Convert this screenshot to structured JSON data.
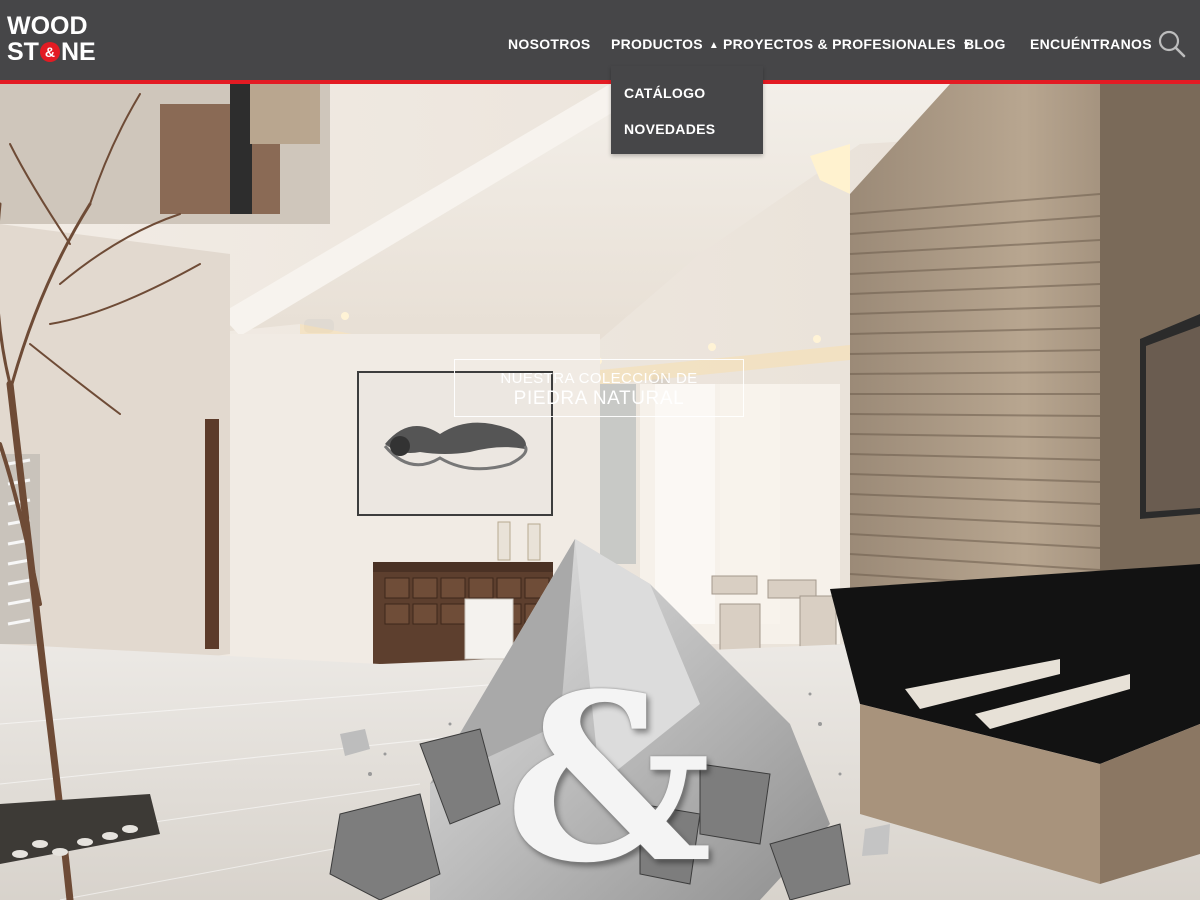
{
  "logo": {
    "line1": "WOOD",
    "line2a": "ST",
    "amp": "&",
    "line2b": "NE"
  },
  "nav": {
    "items": [
      {
        "label": "NOSOTROS"
      },
      {
        "label": "PRODUCTOS",
        "caret": "▲"
      },
      {
        "label": "PROYECTOS & PROFESIONALES",
        "caret": "▼"
      },
      {
        "label": "BLOG"
      },
      {
        "label": "ENCUÉNTRANOS"
      }
    ],
    "search_icon": "search-icon"
  },
  "dropdown": {
    "items": [
      {
        "label": "CATÁLOGO"
      },
      {
        "label": "NOVEDADES"
      }
    ]
  },
  "hero": {
    "line1": "NUESTRA COLECCIÓN DE",
    "line2": "PIEDRA NATURAL",
    "ampersand": "&"
  },
  "colors": {
    "header_bg": "#464648",
    "accent_red": "#e31b23",
    "text_white": "#ffffff"
  }
}
